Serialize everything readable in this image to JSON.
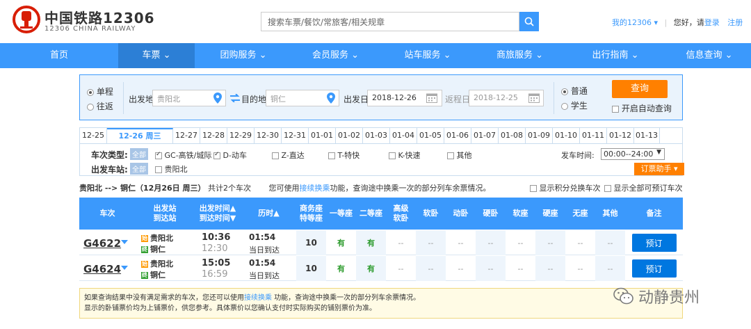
{
  "header": {
    "brand_cn": "中国铁路12306",
    "brand_en": "12306 CHINA RAILWAY",
    "search_placeholder": "搜索车票/餐饮/常旅客/相关规章",
    "my12306": "我的12306",
    "hello": "您好，请",
    "login": "登录",
    "register": "注册"
  },
  "nav": [
    {
      "label": "首页",
      "width": 170
    },
    {
      "label": "车票 ⌄",
      "width": 110
    },
    {
      "label": "团购服务 ⌄",
      "width": 140
    },
    {
      "label": "会员服务 ⌄",
      "width": 125
    },
    {
      "label": "站车服务 ⌄",
      "width": 140
    },
    {
      "label": "商旅服务 ⌄",
      "width": 125
    },
    {
      "label": "出行指南 ⌄",
      "width": 150
    },
    {
      "label": "信息查询 ⌄",
      "width": 120
    }
  ],
  "query": {
    "one_way": "单程",
    "round_trip": "往返",
    "from_label": "出发地",
    "from_value": "贵阳北",
    "to_label": "目的地",
    "to_value": "铜仁",
    "depart_label": "出发日",
    "depart_value": "2018-12-26",
    "return_label": "返程日",
    "return_value": "2018-12-25",
    "normal": "普通",
    "student": "学生",
    "search_btn": "查询",
    "auto_query": "开启自动查询"
  },
  "dates": [
    "12-25",
    "12-26 周三",
    "12-27",
    "12-28",
    "12-29",
    "12-30",
    "12-31",
    "01-01",
    "01-02",
    "01-03",
    "01-04",
    "01-05",
    "01-06",
    "01-07",
    "01-08",
    "01-09",
    "01-10",
    "01-11",
    "01-12",
    "01-13"
  ],
  "filter": {
    "type_label": "车次类型:",
    "all": "全部",
    "types": [
      {
        "label": "GC-高铁/城际",
        "checked": true
      },
      {
        "label": "D-动车",
        "checked": true
      },
      {
        "label": "Z-直达",
        "checked": false
      },
      {
        "label": "T-特快",
        "checked": false
      },
      {
        "label": "K-快速",
        "checked": false
      },
      {
        "label": "其他",
        "checked": false
      }
    ],
    "station_label": "出发车站:",
    "station": "贵阳北",
    "time_label": "发车时间:",
    "time_value": "00:00--24:00",
    "helper": "订票助手 ▾"
  },
  "summary": {
    "route": "贵阳北 --> 铜仁（12月26日 周三）",
    "count": "共计2个车次",
    "hint1": "您可使用",
    "hint_link": "接续换乘",
    "hint2": "功能，查询途中换乘一次的部分列车余票情况。",
    "opt1": "显示积分兑换车次",
    "opt2": "显示全部可预订车次"
  },
  "table": {
    "headers": [
      "车次",
      "出发站\n到达站",
      "出发时间▲\n到达时间▼",
      "历时▲",
      "商务座\n特等座",
      "一等座",
      "二等座",
      "高级\n软卧",
      "软卧",
      "动卧",
      "硬卧",
      "软座",
      "硬座",
      "无座",
      "其他",
      "备注"
    ],
    "rows": [
      {
        "train": "G4622",
        "from": "贵阳北",
        "to": "铜仁",
        "from_tag": "始",
        "to_tag": "终",
        "dep": "10:36",
        "arr": "12:30",
        "dur": "01:54",
        "day": "当日到达",
        "biz": "10",
        "first": "有",
        "second": "有",
        "rest": [
          "--",
          "--",
          "--",
          "--",
          "--",
          "--",
          "--",
          "--"
        ],
        "book": "预订"
      },
      {
        "train": "G4624",
        "from": "贵阳北",
        "to": "铜仁",
        "from_tag": "始",
        "to_tag": "终",
        "dep": "15:05",
        "arr": "16:59",
        "dur": "01:54",
        "day": "当日到达",
        "biz": "10",
        "first": "有",
        "second": "有",
        "rest": [
          "--",
          "--",
          "--",
          "--",
          "--",
          "--",
          "--",
          "--"
        ],
        "book": "预订"
      }
    ]
  },
  "tip": {
    "line1a": "如果查询结果中没有满足需求的车次，您还可以使用",
    "line1_link": "接续换乘",
    "line1b": "功能，查询途中换乘一次的部分列车余票情况。",
    "line2": "显示的卧铺票价均为上铺票价，供您参考。具体票价以您确认支付时实际购买的铺别票价为准。"
  },
  "watermark": "动静贵州",
  "colors": {
    "primary": "#3b99fc",
    "accent": "#ff8000",
    "available": "#2a9a2a"
  }
}
